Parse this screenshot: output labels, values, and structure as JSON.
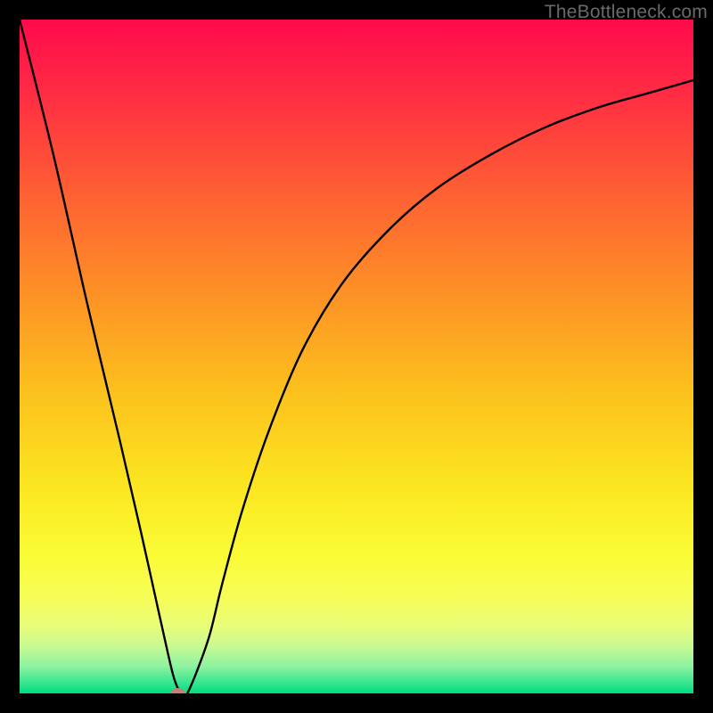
{
  "watermark": "TheBottleneck.com",
  "chart_data": {
    "type": "line",
    "title": "",
    "xlabel": "",
    "ylabel": "",
    "xlim": [
      0,
      100
    ],
    "ylim": [
      0,
      100
    ],
    "grid": false,
    "legend": false,
    "series": [
      {
        "name": "bottleneck-curve",
        "x": [
          0,
          5,
          10,
          15,
          18,
          20,
          22,
          23,
          24,
          25,
          28,
          30,
          33,
          37,
          42,
          48,
          55,
          62,
          70,
          78,
          86,
          93,
          100
        ],
        "y": [
          100,
          80,
          58,
          37,
          24,
          15,
          6,
          2,
          0,
          0.2,
          8,
          16,
          27,
          39,
          51,
          61,
          69,
          75,
          80,
          84,
          87,
          89,
          91
        ],
        "color": "#000000",
        "line_width": 2
      }
    ],
    "marker": {
      "x": 23.5,
      "y": 0,
      "color": "#c77f72",
      "rx": 8,
      "ry": 6
    },
    "background_gradient": {
      "stops": [
        {
          "offset": 0.0,
          "color": "#ff0a4c"
        },
        {
          "offset": 0.1,
          "color": "#ff2944"
        },
        {
          "offset": 0.25,
          "color": "#fe5d34"
        },
        {
          "offset": 0.4,
          "color": "#fd8f26"
        },
        {
          "offset": 0.55,
          "color": "#fcc01d"
        },
        {
          "offset": 0.7,
          "color": "#fbe821"
        },
        {
          "offset": 0.8,
          "color": "#fafc37"
        },
        {
          "offset": 0.86,
          "color": "#f6fd58"
        },
        {
          "offset": 0.9,
          "color": "#e8fd79"
        },
        {
          "offset": 0.93,
          "color": "#c8fa93"
        },
        {
          "offset": 0.96,
          "color": "#8df2a0"
        },
        {
          "offset": 0.985,
          "color": "#35e58f"
        },
        {
          "offset": 1.0,
          "color": "#00dd80"
        }
      ]
    }
  }
}
